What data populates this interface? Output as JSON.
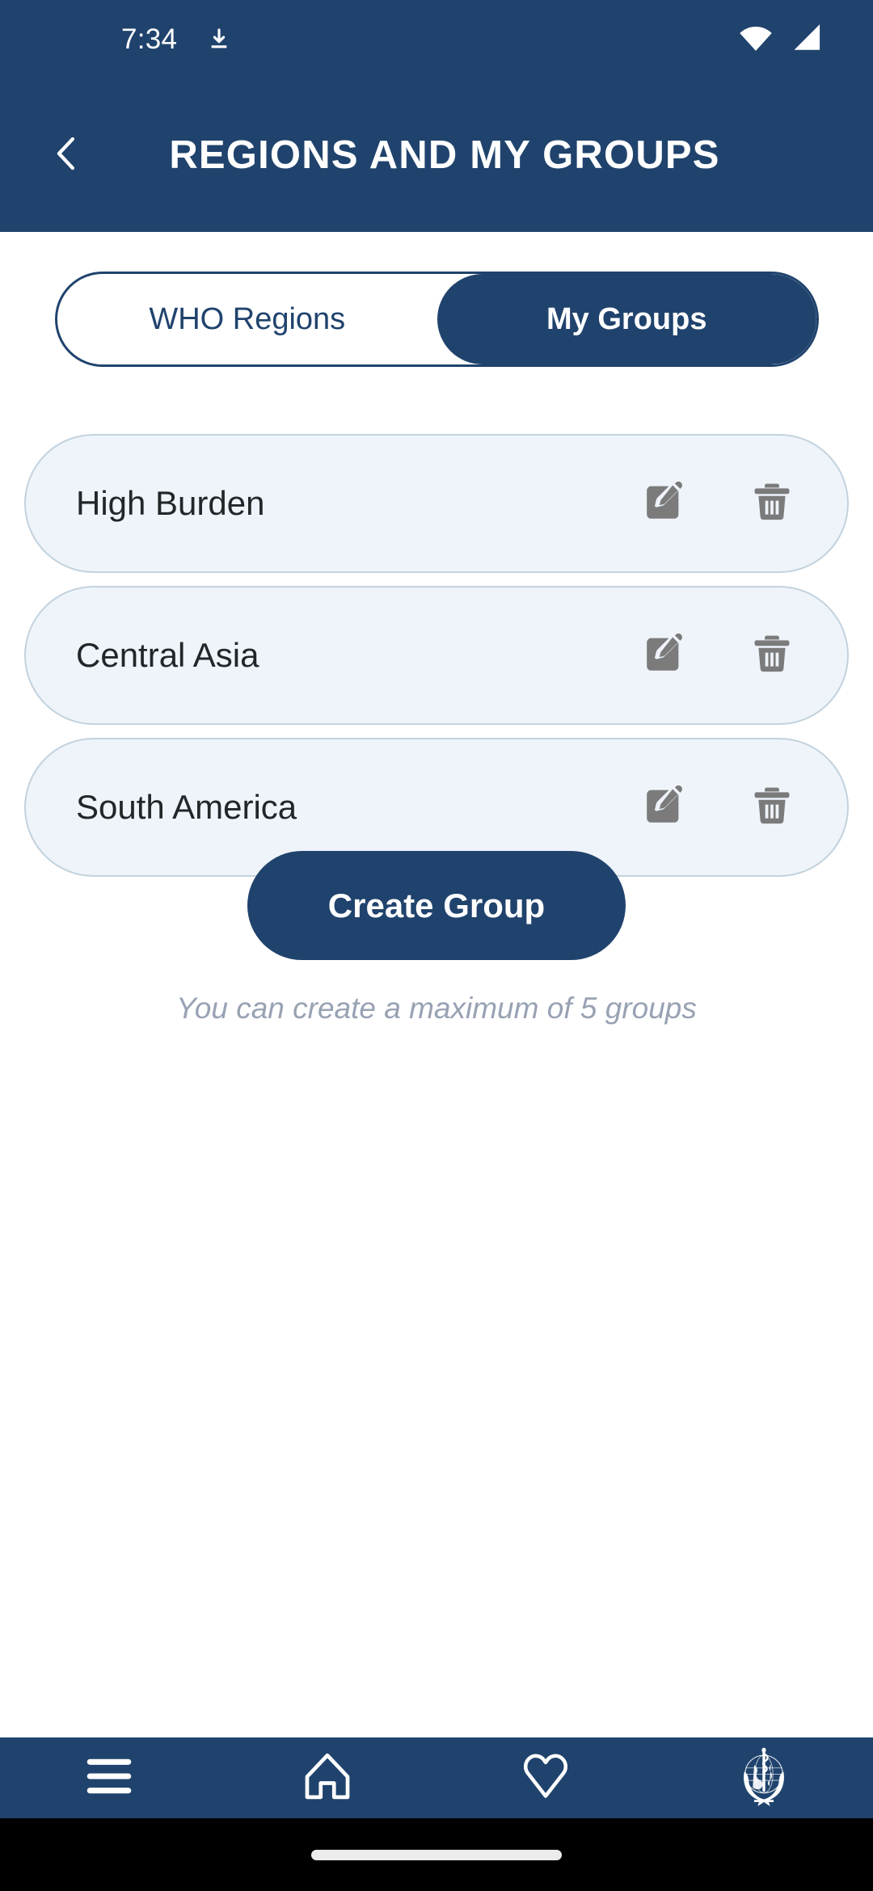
{
  "status_bar": {
    "time": "7:34",
    "download_icon": "download-icon",
    "wifi_icon": "wifi-icon",
    "signal_icon": "cellular-signal-icon"
  },
  "app_bar": {
    "back_icon": "back-chevron-icon",
    "title": "REGIONS AND MY GROUPS"
  },
  "tabs": {
    "items": [
      {
        "label": "WHO Regions",
        "active": false
      },
      {
        "label": "My Groups",
        "active": true
      }
    ]
  },
  "groups": {
    "rows": [
      {
        "name": "High Burden",
        "edit_icon": "edit-icon",
        "delete_icon": "trash-icon"
      },
      {
        "name": "Central Asia",
        "edit_icon": "edit-icon",
        "delete_icon": "trash-icon"
      },
      {
        "name": "South America",
        "edit_icon": "edit-icon",
        "delete_icon": "trash-icon"
      }
    ]
  },
  "actions": {
    "create_label": "Create Group",
    "hint": "You can create a maximum of 5 groups"
  },
  "bottom_nav": {
    "items": [
      {
        "icon": "hamburger-menu-icon"
      },
      {
        "icon": "home-icon"
      },
      {
        "icon": "heart-icon"
      },
      {
        "icon": "who-logo-icon"
      }
    ]
  },
  "colors": {
    "brand_blue": "#20436d",
    "row_bg": "#eef4fa",
    "row_border": "#c3d2dd",
    "hint_gray": "#98a2b3",
    "icon_gray": "#7b7b7b"
  }
}
